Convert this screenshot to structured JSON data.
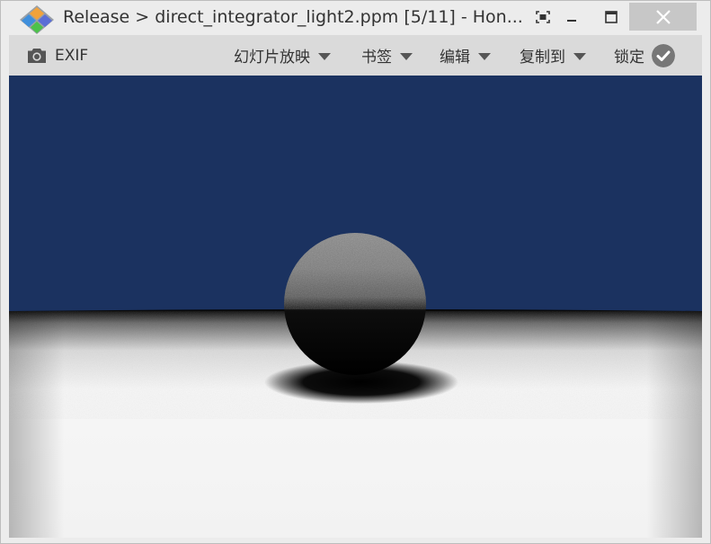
{
  "window": {
    "title": "Release > direct_integrator_light2.ppm [5/11] - Hon..."
  },
  "toolbar": {
    "exif_label": "EXIF",
    "slideshow_label": "幻灯片放映",
    "bookmark_label": "书签",
    "edit_label": "编辑",
    "copyto_label": "复制到",
    "lock_label": "锁定"
  },
  "icons": {
    "app": "honeyview-diamond-logo",
    "camera": "camera-icon",
    "capture": "screen-capture-icon",
    "minimize": "minimize-icon",
    "maximize": "maximize-icon",
    "close": "close-icon",
    "lock_check": "check-circle-icon"
  },
  "colors": {
    "sky": "#1b3260",
    "floor": "#f4f4f4",
    "close_button": "#c7c7c7",
    "toolbar_bg": "#dadada"
  }
}
